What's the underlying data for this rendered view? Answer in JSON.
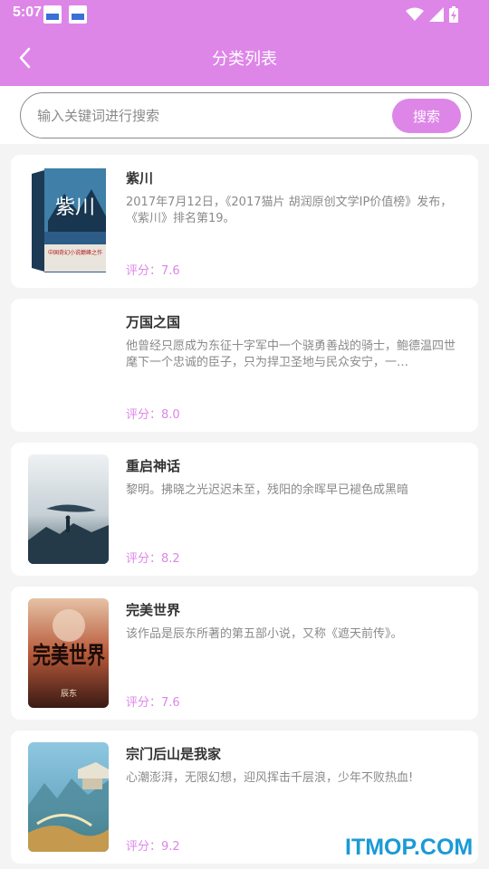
{
  "status_bar": {
    "time": "5:07",
    "notification_icons": [
      "app-notification-icon",
      "app-notification-icon"
    ],
    "system_icons": [
      "wifi-icon",
      "signal-icon",
      "battery-charging-icon"
    ]
  },
  "header": {
    "title": "分类列表",
    "back_icon": "chevron-left-icon"
  },
  "search": {
    "placeholder": "输入关键词进行搜索",
    "value": "",
    "button_label": "搜索"
  },
  "books": [
    {
      "title": "紫川",
      "description": "2017年7月12日，《2017猫片 胡润原创文学IP价值榜》发布，《紫川》排名第19。",
      "rating_label": "评分：",
      "rating": "7.6",
      "cover": "zichuan-cover"
    },
    {
      "title": "万国之国",
      "description": "他曾经只愿成为东征十字军中一个骁勇善战的骑士，鲍德温四世麾下一个忠诚的臣子，只为捍卫圣地与民众安宁，一…",
      "rating_label": "评分：",
      "rating": "8.0",
      "cover": ""
    },
    {
      "title": "重启神话",
      "description": "黎明。拂晓之光迟迟未至，残阳的余晖早已褪色成黑暗",
      "rating_label": "评分：",
      "rating": "8.2",
      "cover": "chongqi-cover"
    },
    {
      "title": "完美世界",
      "description": "该作品是辰东所著的第五部小说，又称《遮天前传》。",
      "rating_label": "评分：",
      "rating": "7.6",
      "cover": "wanmei-cover"
    },
    {
      "title": "宗门后山是我家",
      "description": "心潮澎湃，无限幻想，迎风挥击千层浪，少年不败热血!",
      "rating_label": "评分：",
      "rating": "9.2",
      "cover": "zongmen-cover"
    }
  ],
  "cover_text": {
    "zichuan_title": "紫川",
    "zichuan_sub": "中国奇幻小说巅峰之作",
    "wanmei_title": "完美世界",
    "wanmei_author": "辰东"
  },
  "watermark": "ITMOP.COM",
  "colors": {
    "accent": "#dd86e8",
    "background": "#f4f4f4",
    "watermark": "#1a9ad6"
  }
}
